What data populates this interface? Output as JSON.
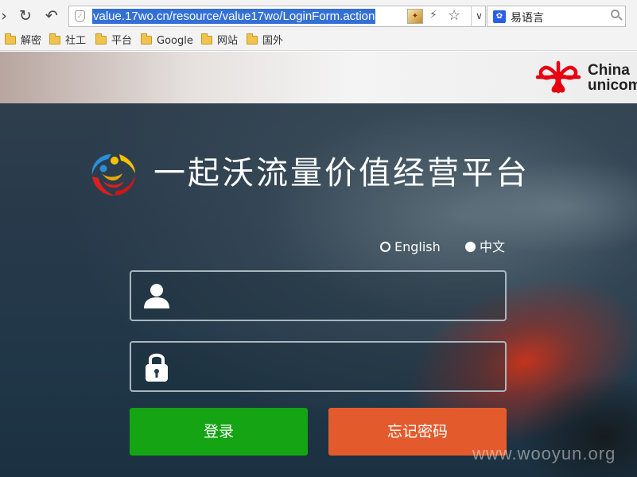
{
  "browser": {
    "address_bar": {
      "url": "value.17wo.cn/resource/value17wo/LoginForm.action"
    },
    "search_bar": {
      "value": "易语言"
    },
    "bookmarks": [
      "解密",
      "社工",
      "平台",
      "Google",
      "网站",
      "国外"
    ]
  },
  "header": {
    "brand_text_line1": "China",
    "brand_text_line2": "unicom"
  },
  "login": {
    "title": "一起沃流量价值经营平台",
    "languages": [
      {
        "label": "English",
        "selected": false
      },
      {
        "label": "中文",
        "selected": true
      }
    ],
    "username": {
      "value": ""
    },
    "password": {
      "value": ""
    },
    "login_button": "登录",
    "forgot_button": "忘记密码"
  },
  "watermark": "www.wooyun.org",
  "colors": {
    "login_button": "#14a414",
    "forgot_button": "#e35b2c",
    "url_highlight": "#3370d6",
    "unicom_red": "#e60012"
  },
  "icons": [
    "forward-icon",
    "reload-icon",
    "undo-icon",
    "shield-icon",
    "extension-icon",
    "lightning-icon",
    "bookmark-star-icon",
    "dropdown-chevron-icon",
    "baidu-icon",
    "search-icon",
    "folder-icon",
    "china-unicom-logo",
    "site-logo",
    "user-icon",
    "lock-icon"
  ]
}
